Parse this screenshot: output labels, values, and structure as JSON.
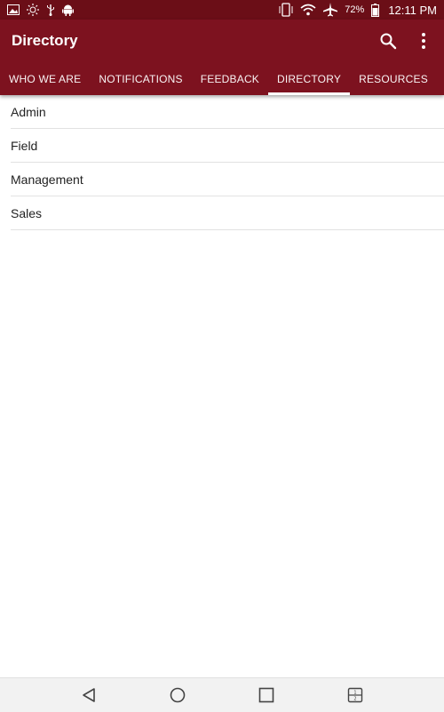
{
  "status_bar": {
    "battery": "72%",
    "time": "12:11 PM",
    "icons_left": [
      "image-icon",
      "brightness-icon",
      "usb-icon",
      "android-icon"
    ],
    "icons_right": [
      "phone-rotate-icon",
      "wifi-icon",
      "airplane-icon",
      "battery-icon"
    ]
  },
  "app_bar": {
    "title": "Directory",
    "actions": [
      "search-icon",
      "more-vert-icon"
    ],
    "color": "#7d121f"
  },
  "tabs": [
    {
      "label": "WHO WE ARE",
      "active": false
    },
    {
      "label": "NOTIFICATIONS",
      "active": false
    },
    {
      "label": "FEEDBACK",
      "active": false
    },
    {
      "label": "DIRECTORY",
      "active": true
    },
    {
      "label": "RESOURCES",
      "active": false
    }
  ],
  "list": {
    "items": [
      "Admin",
      "Field",
      "Management",
      "Sales"
    ]
  },
  "nav_bar": {
    "buttons": [
      "back-icon",
      "home-icon",
      "recents-icon",
      "dual-window-icon"
    ]
  }
}
